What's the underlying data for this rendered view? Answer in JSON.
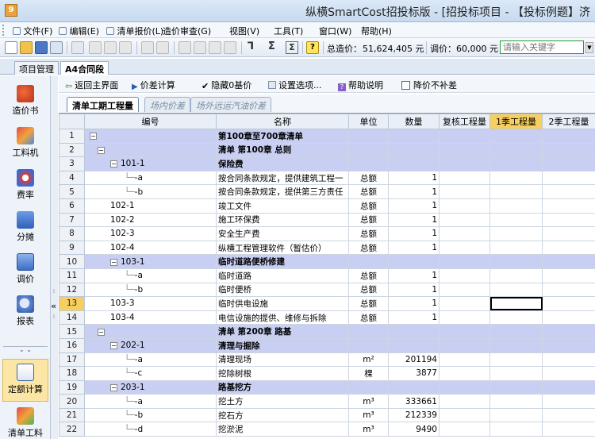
{
  "window": {
    "title": "纵横SmartCost招投标版 - [招投标项目 - 【投标例题】济",
    "app_icon": "9"
  },
  "menu": [
    {
      "label": "文件(F)"
    },
    {
      "label": "编辑(E)"
    },
    {
      "label": "清单报价(L)"
    },
    {
      "label": "造价审查(G)"
    },
    {
      "label": "视图(V)"
    },
    {
      "label": "工具(T)"
    },
    {
      "label": "窗口(W)"
    },
    {
      "label": "帮助(H)"
    }
  ],
  "toolbar": {
    "total_label": "总造价：",
    "total_value": "51,624,405 元",
    "adjust_label": "调价：",
    "adjust_value": "60,000 元",
    "keyword_placeholder": "请输入关键字"
  },
  "doc_tabs": [
    {
      "label": "项目管理"
    },
    {
      "label": "A4合同段"
    }
  ],
  "left_panel": [
    {
      "label": "造价书",
      "icon": "book-icon"
    },
    {
      "label": "工料机",
      "icon": "machine-icon"
    },
    {
      "label": "费率",
      "icon": "rate-icon"
    },
    {
      "label": "分摊",
      "icon": "share-icon"
    },
    {
      "label": "调价",
      "icon": "adjust-icon"
    },
    {
      "label": "报表",
      "icon": "report-icon"
    },
    {
      "label": "定额计算",
      "icon": "quota-icon"
    },
    {
      "label": "清单工料",
      "icon": "list-material-icon"
    }
  ],
  "actions": {
    "back": "返回主界面",
    "diff_calc": "价差计算",
    "hide_zero": "隐藏0基价",
    "settings": "设置选项...",
    "help": "帮助说明",
    "no_diff": "降价不补差"
  },
  "sub_tabs": [
    {
      "label": "清单工期工程量"
    },
    {
      "label": "场内价差"
    },
    {
      "label": "场外远运汽油价差"
    }
  ],
  "grid": {
    "columns": [
      "编号",
      "名称",
      "单位",
      "数量",
      "复核工程量",
      "1季工程量",
      "2季工程量"
    ],
    "rows": [
      {
        "no": "1",
        "code": "",
        "name": "第100章至700章清单",
        "unit": "",
        "qty": "",
        "level": 0,
        "hdr": true
      },
      {
        "no": "2",
        "code": "",
        "name": "清单 第100章  总则",
        "unit": "",
        "qty": "",
        "level": 1,
        "hdr": true
      },
      {
        "no": "3",
        "code": "101-1",
        "name": "保险费",
        "unit": "",
        "qty": "",
        "level": 2,
        "hdr": true
      },
      {
        "no": "4",
        "code": "-a",
        "name": "按合同条款规定，提供建筑工程一",
        "unit": "总额",
        "qty": "1",
        "level": 3
      },
      {
        "no": "5",
        "code": "-b",
        "name": "按合同条款规定，提供第三方责任",
        "unit": "总额",
        "qty": "1",
        "level": 3
      },
      {
        "no": "6",
        "code": "102-1",
        "name": "竣工文件",
        "unit": "总额",
        "qty": "1",
        "level": 2
      },
      {
        "no": "7",
        "code": "102-2",
        "name": "施工环保费",
        "unit": "总额",
        "qty": "1",
        "level": 2
      },
      {
        "no": "8",
        "code": "102-3",
        "name": "安全生产费",
        "unit": "总额",
        "qty": "1",
        "level": 2
      },
      {
        "no": "9",
        "code": "102-4",
        "name": "纵横工程管理软件（暂估价）",
        "unit": "总额",
        "qty": "1",
        "level": 2
      },
      {
        "no": "10",
        "code": "103-1",
        "name": "临时道路便桥修建",
        "unit": "",
        "qty": "",
        "level": 2,
        "hdr": true
      },
      {
        "no": "11",
        "code": "-a",
        "name": "临时道路",
        "unit": "总额",
        "qty": "1",
        "level": 3
      },
      {
        "no": "12",
        "code": "-b",
        "name": "临时便桥",
        "unit": "总额",
        "qty": "1",
        "level": 3
      },
      {
        "no": "13",
        "code": "103-3",
        "name": "临时供电设施",
        "unit": "总额",
        "qty": "1",
        "level": 2,
        "cur": true
      },
      {
        "no": "14",
        "code": "103-4",
        "name": "电信设施的提供、维修与拆除",
        "unit": "总额",
        "qty": "1",
        "level": 2
      },
      {
        "no": "15",
        "code": "",
        "name": "清单 第200章  路基",
        "unit": "",
        "qty": "",
        "level": 1,
        "hdr": true
      },
      {
        "no": "16",
        "code": "202-1",
        "name": "清理与掘除",
        "unit": "",
        "qty": "",
        "level": 2,
        "hdr": true
      },
      {
        "no": "17",
        "code": "-a",
        "name": "清理现场",
        "unit": "m²",
        "qty": "201194",
        "level": 3
      },
      {
        "no": "18",
        "code": "-c",
        "name": "挖除树根",
        "unit": "棵",
        "qty": "3877",
        "level": 3
      },
      {
        "no": "19",
        "code": "203-1",
        "name": "路基挖方",
        "unit": "",
        "qty": "",
        "level": 2,
        "hdr": true
      },
      {
        "no": "20",
        "code": "-a",
        "name": "挖土方",
        "unit": "m³",
        "qty": "333661",
        "level": 3
      },
      {
        "no": "21",
        "code": "-b",
        "name": "挖石方",
        "unit": "m³",
        "qty": "212339",
        "level": 3
      },
      {
        "no": "22",
        "code": "-d",
        "name": "挖淤泥",
        "unit": "m³",
        "qty": "9490",
        "level": 3
      }
    ]
  }
}
